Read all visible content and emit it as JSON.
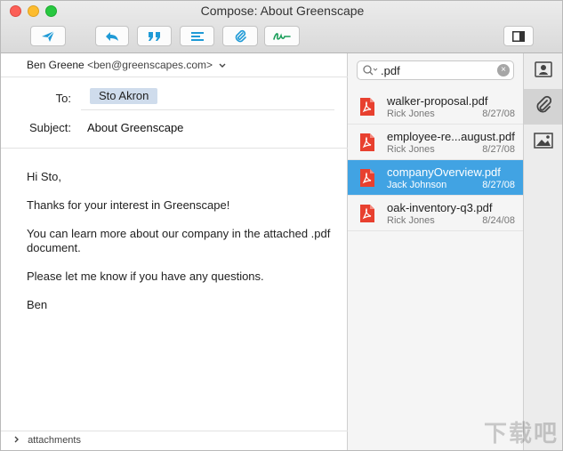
{
  "window": {
    "title": "Compose: About Greenscape"
  },
  "toolbar": {
    "buttons": [
      {
        "name": "send-icon"
      },
      {
        "name": "reply-icon"
      },
      {
        "name": "quote-icon"
      },
      {
        "name": "format-icon"
      },
      {
        "name": "attachment-icon"
      },
      {
        "name": "signature-icon"
      },
      {
        "name": "sidebar-toggle-icon"
      }
    ]
  },
  "compose": {
    "from_name": "Ben Greene",
    "from_address": "<ben@greenscapes.com>",
    "to_label": "To:",
    "to_recipient": "Sto Akron",
    "subject_label": "Subject:",
    "subject_value": "About Greenscape",
    "body": [
      "Hi Sto,",
      "Thanks for your interest in Greenscape!",
      "You can learn more about our company in the attached .pdf document.",
      "Please let me know if you have any questions.",
      "Ben"
    ],
    "attachments_label": "attachments"
  },
  "files": {
    "search_query": ".pdf",
    "items": [
      {
        "name": "walker-proposal.pdf",
        "author": "Rick Jones",
        "date": "8/27/08",
        "selected": false
      },
      {
        "name": "employee-re...august.pdf",
        "author": "Rick Jones",
        "date": "8/27/08",
        "selected": false
      },
      {
        "name": "companyOverview.pdf",
        "author": "Jack Johnson",
        "date": "8/27/08",
        "selected": true
      },
      {
        "name": "oak-inventory-q3.pdf",
        "author": "Rick Jones",
        "date": "8/24/08",
        "selected": false
      }
    ]
  },
  "rail": {
    "items": [
      {
        "name": "contacts-icon",
        "active": false
      },
      {
        "name": "paperclip-icon",
        "active": true
      },
      {
        "name": "image-icon",
        "active": false
      }
    ]
  },
  "colors": {
    "accent": "#41a3e3",
    "toolbar_icon": "#1f9ad6",
    "signature_icon": "#1a9e5a",
    "pdf": "#e8402f"
  },
  "watermark": "下载吧"
}
